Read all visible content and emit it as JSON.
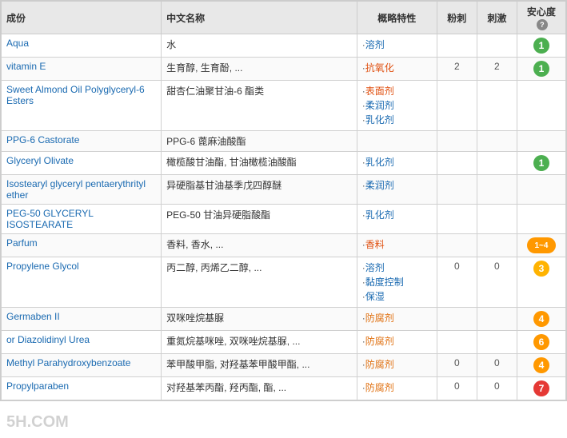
{
  "headers": {
    "ingredient": "成份",
    "chinese_name": "中文名称",
    "property": "概略特性",
    "powder": "粉刺",
    "irritation": "刺激",
    "safety": "安心度",
    "help": "?"
  },
  "rows": [
    {
      "ingredient": "Aqua",
      "chinese": "水",
      "properties": [
        {
          "text": "溶剂",
          "class": "prop-blue"
        }
      ],
      "powder": "",
      "irritation": "",
      "safety_val": "1",
      "safety_class": "badge-green"
    },
    {
      "ingredient": "vitamin E",
      "chinese": "生育醇, 生育酚, ...",
      "properties": [
        {
          "text": "抗氧化",
          "class": "prop-highlight"
        }
      ],
      "powder": "2",
      "irritation": "2",
      "safety_val": "1",
      "safety_class": "badge-green"
    },
    {
      "ingredient": "Sweet Almond Oil Polyglyceryl-6 Esters",
      "chinese": "甜杏仁油聚甘油-6 酯类",
      "properties": [
        {
          "text": "表面剂",
          "class": "prop-highlight"
        },
        {
          "text": "柔润剂",
          "class": "prop-blue"
        },
        {
          "text": "乳化剂",
          "class": "prop-blue"
        }
      ],
      "powder": "",
      "irritation": "",
      "safety_val": "",
      "safety_class": ""
    },
    {
      "ingredient": "PPG-6 Castorate",
      "chinese": "PPG-6 蓖麻油酸酯",
      "properties": [],
      "powder": "",
      "irritation": "",
      "safety_val": "",
      "safety_class": ""
    },
    {
      "ingredient": "Glyceryl Olivate",
      "chinese": "橄榄酸甘油酯, 甘油橄榄油酸酯",
      "properties": [
        {
          "text": "乳化剂",
          "class": "prop-blue"
        }
      ],
      "powder": "",
      "irritation": "",
      "safety_val": "1",
      "safety_class": "badge-green"
    },
    {
      "ingredient": "Isostearyl glyceryl pentaerythrityl ether",
      "chinese": "异硬脂基甘油基季戊四醇醚",
      "properties": [
        {
          "text": "柔润剂",
          "class": "prop-blue"
        }
      ],
      "powder": "",
      "irritation": "",
      "safety_val": "",
      "safety_class": ""
    },
    {
      "ingredient": "PEG-50 GLYCERYL ISOSTEARATE",
      "chinese": "PEG-50 甘油异硬脂酸酯",
      "properties": [
        {
          "text": "乳化剂",
          "class": "prop-blue"
        }
      ],
      "powder": "",
      "irritation": "",
      "safety_val": "",
      "safety_class": ""
    },
    {
      "ingredient": "Parfum",
      "chinese": "香料, 香水, ...",
      "properties": [
        {
          "text": "香料",
          "class": "prop-highlight"
        }
      ],
      "powder": "",
      "irritation": "",
      "safety_val": "1~4",
      "safety_class": "badge-orange",
      "safety_text": "1~4"
    },
    {
      "ingredient": "Propylene Glycol",
      "chinese": "丙二醇, 丙烯乙二醇, ...",
      "properties": [
        {
          "text": "溶剂",
          "class": "prop-blue"
        },
        {
          "text": "黏度控制",
          "class": "prop-blue"
        },
        {
          "text": "保湿",
          "class": "prop-blue"
        }
      ],
      "powder": "0",
      "irritation": "0",
      "safety_val": "3",
      "safety_class": "badge-yellow"
    },
    {
      "ingredient": "Germaben II",
      "chinese": "双咪唑烷基脲",
      "properties": [
        {
          "text": "防腐剂",
          "class": "prop-orange"
        }
      ],
      "powder": "",
      "irritation": "",
      "safety_val": "4",
      "safety_class": "badge-orange"
    },
    {
      "ingredient": "or Diazolidinyl Urea",
      "chinese": "重氮烷基咪唑, 双咪唑烷基脲, ...",
      "properties": [
        {
          "text": "防腐剂",
          "class": "prop-orange"
        }
      ],
      "powder": "",
      "irritation": "",
      "safety_val": "6",
      "safety_class": "badge-orange"
    },
    {
      "ingredient": "Methyl Parahydroxybenzoate",
      "chinese": "苯甲酸甲脂, 对羟基苯甲酸甲酯, ...",
      "properties": [
        {
          "text": "防腐剂",
          "class": "prop-orange"
        }
      ],
      "powder": "0",
      "irritation": "0",
      "safety_val": "4",
      "safety_class": "badge-orange"
    },
    {
      "ingredient": "Propylparaben",
      "chinese": "对羟基苯丙酯, 羟丙酯, 酯, ...",
      "properties": [
        {
          "text": "防腐剂",
          "class": "prop-orange"
        }
      ],
      "powder": "0",
      "irritation": "0",
      "safety_val": "7",
      "safety_class": "badge-red"
    }
  ],
  "watermark": "5H.COM"
}
